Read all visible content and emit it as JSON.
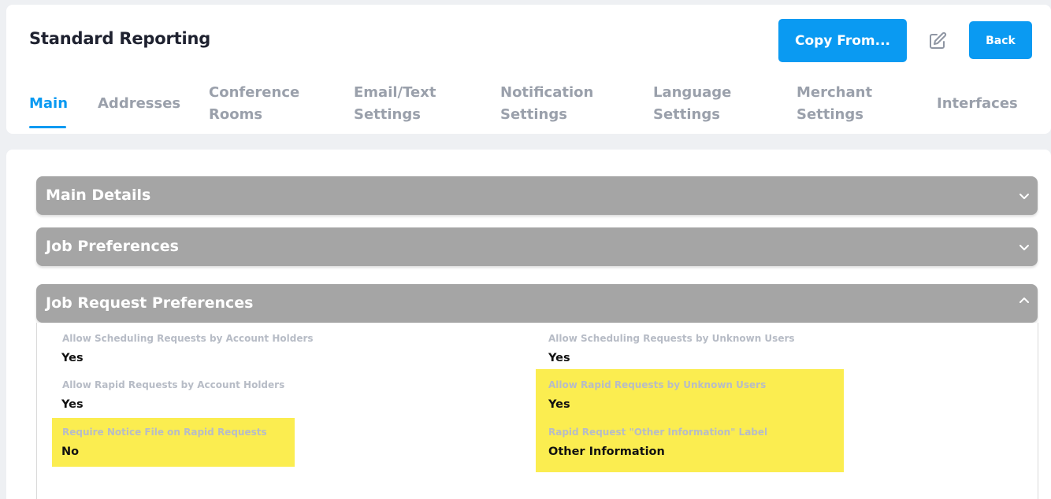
{
  "header": {
    "title": "Standard Reporting",
    "copy_from_label": "Copy From...",
    "back_label": "Back",
    "edit_icon": "edit-pencil-icon"
  },
  "tabs": [
    {
      "label": "Main",
      "active": true
    },
    {
      "label": "Addresses"
    },
    {
      "label": "Conference\nRooms"
    },
    {
      "label": "Email/Text\nSettings"
    },
    {
      "label": "Notification\nSettings"
    },
    {
      "label": "Language\nSettings"
    },
    {
      "label": "Merchant\nSettings"
    },
    {
      "label": "Interfaces"
    }
  ],
  "sections": [
    {
      "title": "Main Details",
      "expanded": false,
      "icon": "chevron-down-icon"
    },
    {
      "title": "Job Preferences",
      "expanded": false,
      "icon": "chevron-down-icon"
    },
    {
      "title": "Job Request Preferences",
      "expanded": true,
      "icon": "chevron-up-icon"
    }
  ],
  "job_request_fields": [
    {
      "label": "Allow Scheduling Requests by Account Holders",
      "value": "Yes"
    },
    {
      "label": "Allow Scheduling Requests by Unknown Users",
      "value": "Yes"
    },
    {
      "label": "Allow Rapid Requests by Account Holders",
      "value": "Yes"
    },
    {
      "label": "Allow Rapid Requests by Unknown Users",
      "value": "Yes"
    },
    {
      "label": "Require Notice File on Rapid Requests",
      "value": "No"
    },
    {
      "label": "Rapid Request \"Other Information\" Label",
      "value": "Other Information"
    }
  ],
  "colors": {
    "accent": "#0a9af2",
    "accordion_header": "#a5a5a5",
    "highlight": "#fbed50",
    "tab_inactive": "#9aa0ab"
  }
}
